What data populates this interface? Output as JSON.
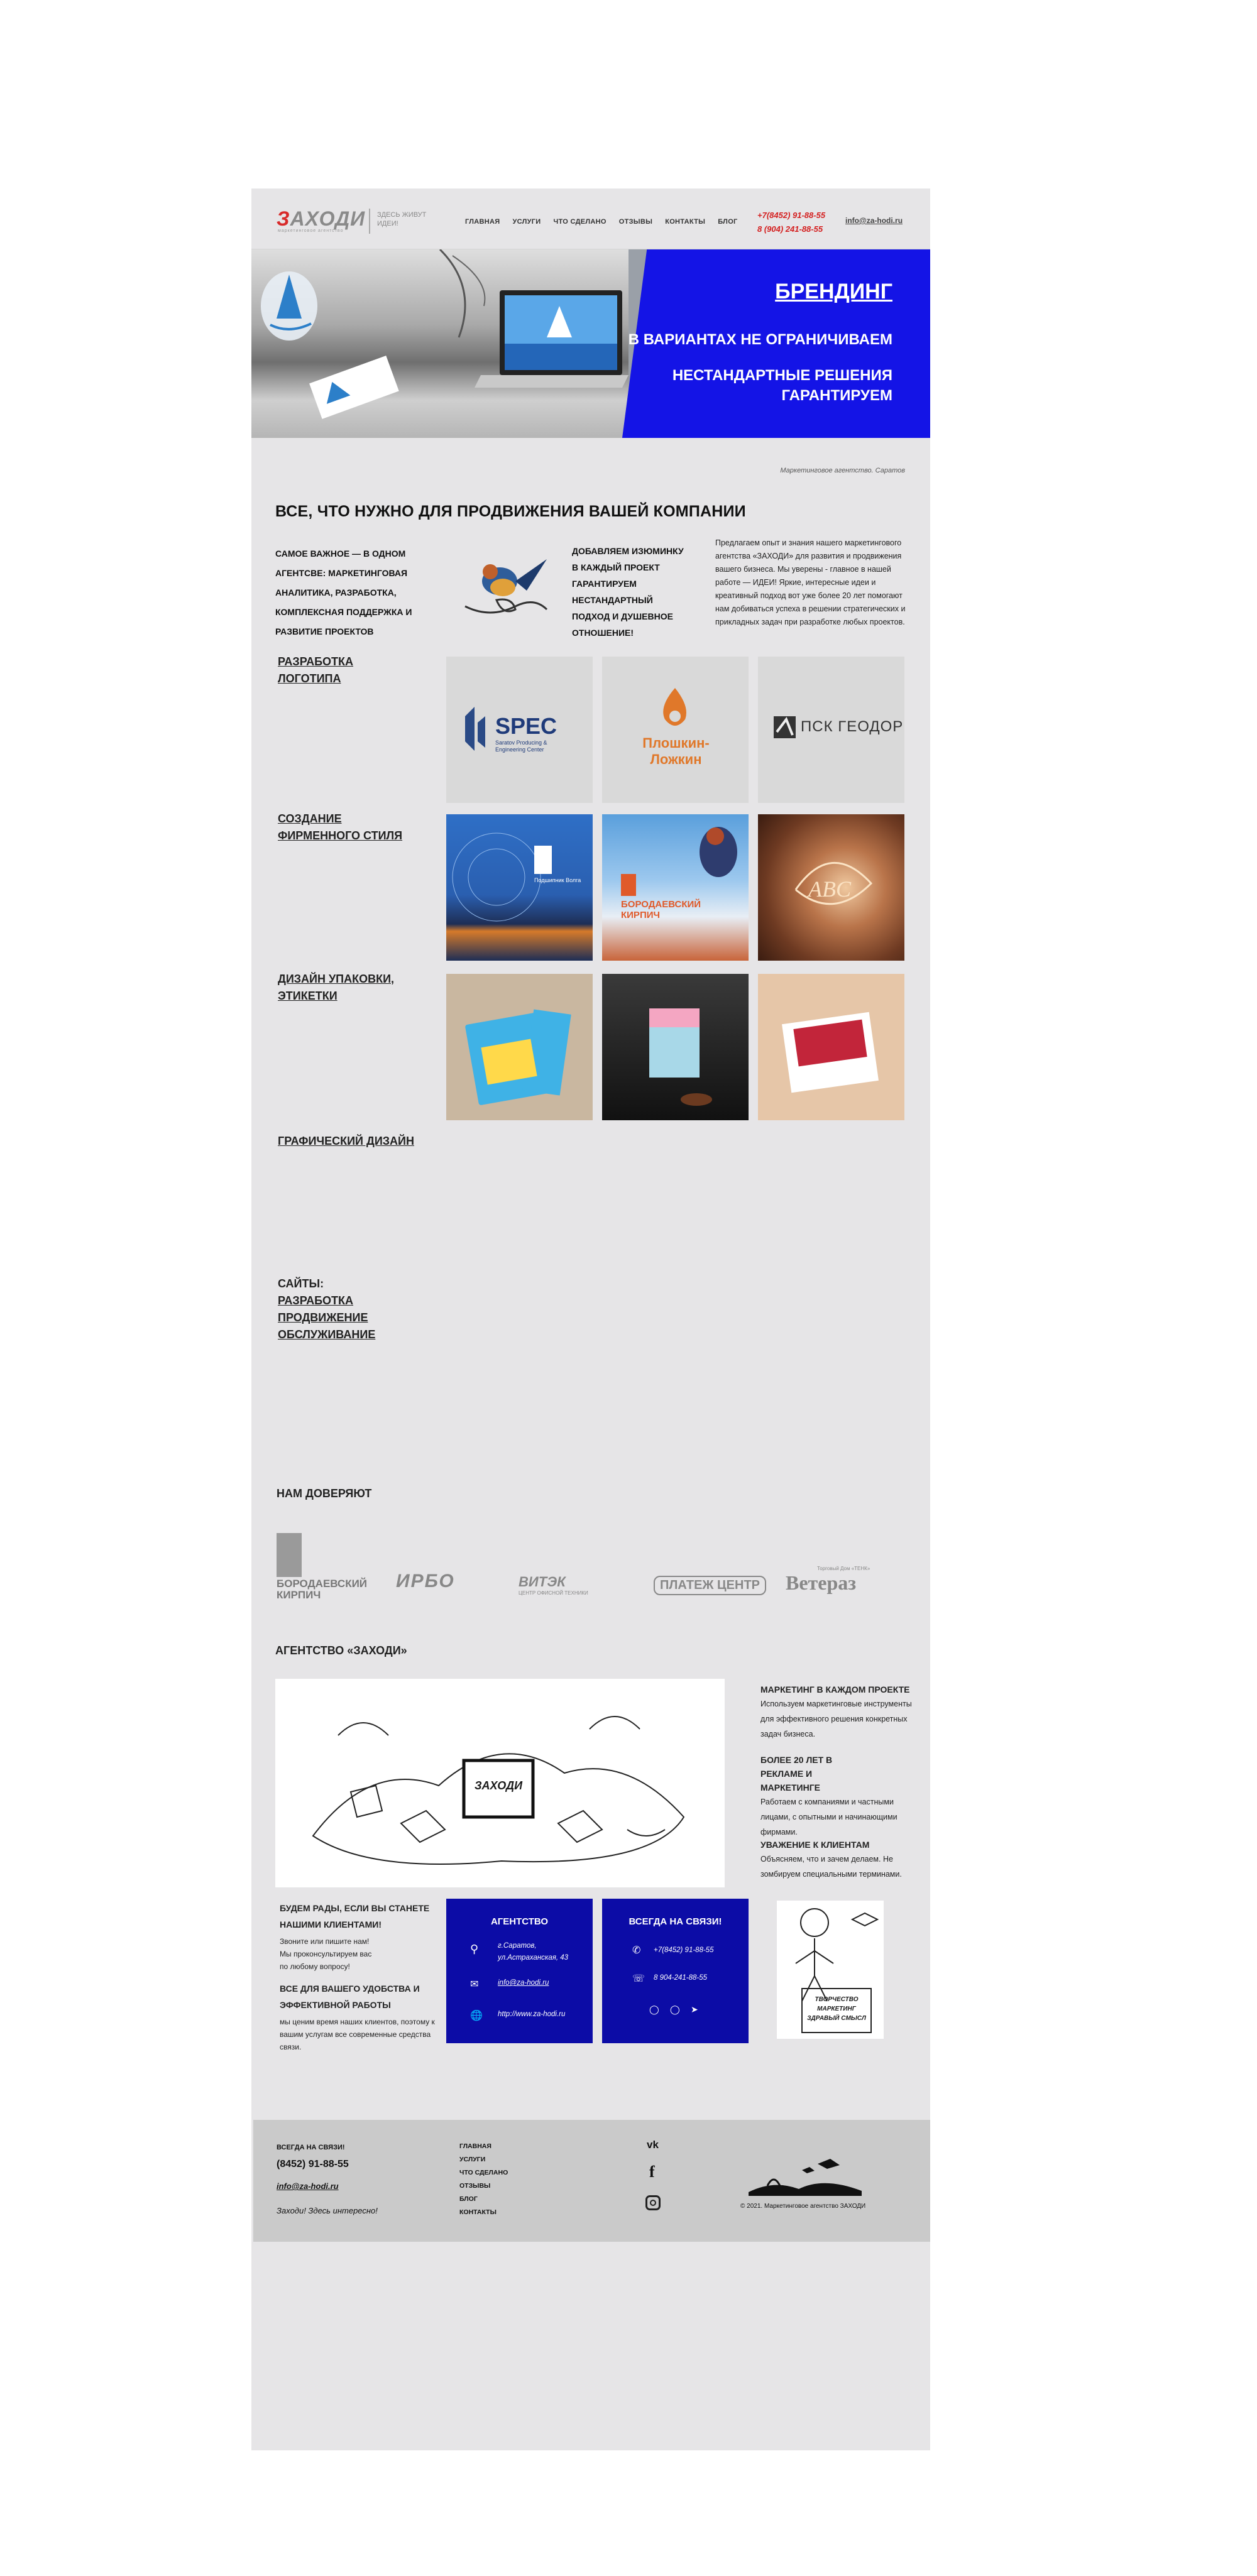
{
  "header": {
    "logo_text": "ЗАХОДИ",
    "logo_sub": "маркетинговое агентство",
    "tagline": "ЗДЕСЬ ЖИВУТ ИДЕИ!",
    "nav": [
      "ГЛАВНАЯ",
      "УСЛУГИ",
      "ЧТО СДЕЛАНО",
      "ОТЗЫВЫ",
      "КОНТАКТЫ",
      "БЛОГ"
    ],
    "phone1": "+7(8452) 91-88-55",
    "phone2": "8 (904) 241-88-55",
    "email": "info@za-hodi.ru"
  },
  "hero": {
    "title": "БРЕНДИНГ",
    "line1": "В ВАРИАНТАХ  НЕ ОГРАНИЧИВАЕМ",
    "line2": "НЕСТАНДАРТНЫЕ РЕШЕНИЯ ГАРАНТИРУЕМ"
  },
  "caption": "Маркетинговое агентство. Саратов",
  "intro": {
    "heading": "ВСЕ, ЧТО НУЖНО ДЛЯ ПРОДВИЖЕНИЯ ВАШЕЙ КОМПАНИИ",
    "left": "САМОЕ ВАЖНОЕ — В ОДНОМ АГЕНТСВЕ: МАРКЕТИНГОВАЯ АНАЛИТИКА, РАЗРАБОТКА, КОМПЛЕКСНАЯ ПОДДЕРЖКА И РАЗВИТИЕ ПРОЕКТОВ",
    "middle": "ДОБАВЛЯЕМ ИЗЮМИНКУ В КАЖДЫЙ ПРОЕКТ ГАРАНТИРУЕМ НЕСТАНДАРТНЫЙ  ПОДХОД И ДУШЕВНОЕ ОТНОШЕНИЕ!",
    "right": "Предлагаем  опыт и знания нашего маркетингового агентства «ЗАХОДИ» для развития и продвижения вашего бизнеса. Мы уверены - главное в нашей работе — ИДЕИ!  Яркие, интересные идеи и креативный подход  вот уже более 20 лет помогают нам добиваться успеха в решении стратегических и прикладных задач при разработке любых проектов."
  },
  "sections": {
    "logo": "РАЗРАБОТКА ЛОГОТИПА",
    "style": "СОЗДАНИЕ ФИРМЕННОГО СТИЛЯ",
    "pack": "ДИЗАЙН УПАКОВКИ, ЭТИКЕТКИ",
    "graphic": "ГРАФИЧЕСКИЙ ДИЗАЙН",
    "sites": [
      "САЙТЫ:",
      "РАЗРАБОТКА",
      "ПРОДВИЖЕНИЕ",
      "ОБСЛУЖИВАНИЕ"
    ]
  },
  "logos": {
    "spec_big": "SPEC",
    "spec_small": "Saratov Producing & Engineering Center",
    "ploshkin": "Плошкин-Ложкин",
    "psk": "ПСК ГЕОДОР",
    "style_2a": "БОРОДАЕВСКИЙ",
    "style_2b": "КИРПИЧ",
    "style_1": "Подшипник Волга",
    "style_3": "ABC"
  },
  "trust": {
    "heading": "НАМ ДОВЕРЯЮТ",
    "items": [
      "БОРОДАЕВСКИЙ КИРПИЧ",
      "ИРБО",
      "ВИТЭК",
      "ПЛАТЕЖ ЦЕНТР",
      "Ветераз"
    ],
    "item_subs": [
      "",
      "",
      "ЦЕНТР ОФИСНОЙ ТЕХНИКИ",
      "",
      "Торговый Дом «ТЕНК»"
    ]
  },
  "agency": {
    "heading": "АГЕНТСТВО «ЗАХОДИ»",
    "sketch_logo": "ЗАХОДИ",
    "f1_title": "МАРКЕТИНГ В КАЖДОМ ПРОЕКТЕ",
    "f1_text": "Используем маркетинговые инструменты для эффективного решения конкретных задач бизнеса.",
    "f2_title": "БОЛЕЕ 20 ЛЕТ В РЕКЛАМЕ И МАРКЕТИНГЕ",
    "f2_text": "Работаем с компаниями и частными лицами, с опытными и начинающими фирмами.",
    "f3_title": "УВАЖЕНИЕ К КЛИЕНТАМ",
    "f3_text": "Объясняем, что и зачем делаем. Не зомбируем специальными терминами."
  },
  "contacts": {
    "welcome_title": "БУДЕМ РАДЫ, ЕСЛИ ВЫ СТАНЕТЕ НАШИМИ КЛИЕНТАМИ!",
    "welcome_text": "Звоните или пишите нам! Мы проконсультируем вас по любому вопросу!",
    "ease_title": "ВСЕ ДЛЯ ВАШЕГО УДОБСТВА И ЭФФЕКТИВНОЙ РАБОТЫ",
    "ease_text": "мы ценим время наших клиентов, поэтому к вашим услугам все современные средства связи.",
    "agency_title": "АГЕНТСТВО",
    "address": "г.Саратов, ул.Астраханская, 43",
    "email": "info@za-hodi.ru",
    "site": "http://www.za-hodi.ru",
    "online_title": "ВСЕГДА НА СВЯЗИ!",
    "phone1": "+7(8452) 91-88-55",
    "phone2": "8 904-241-88-55",
    "poster": "ТВОРЧЕСТВО МАРКЕТИНГ ЗДРАВЫЙ СМЫСЛ"
  },
  "footer": {
    "online": "ВСЕГДА НА СВЯЗИ!",
    "phone": "(8452)  91-88-55",
    "email": "info@za-hodi.ru",
    "slogan": "Заходи! Здесь интересно!",
    "links": [
      "ГЛАВНАЯ",
      "УСЛУГИ",
      "ЧТО СДЕЛАНО",
      "ОТЗЫВЫ",
      "БЛОГ",
      "КОНТАКТЫ"
    ],
    "copyright": "© 2021. Маркетинговое агентство ЗАХОДИ"
  },
  "colors": {
    "accent_blue": "#1414e6",
    "dark_blue": "#0c0ca6",
    "brand_red": "#d42020",
    "page_bg": "#e6e5e7"
  }
}
